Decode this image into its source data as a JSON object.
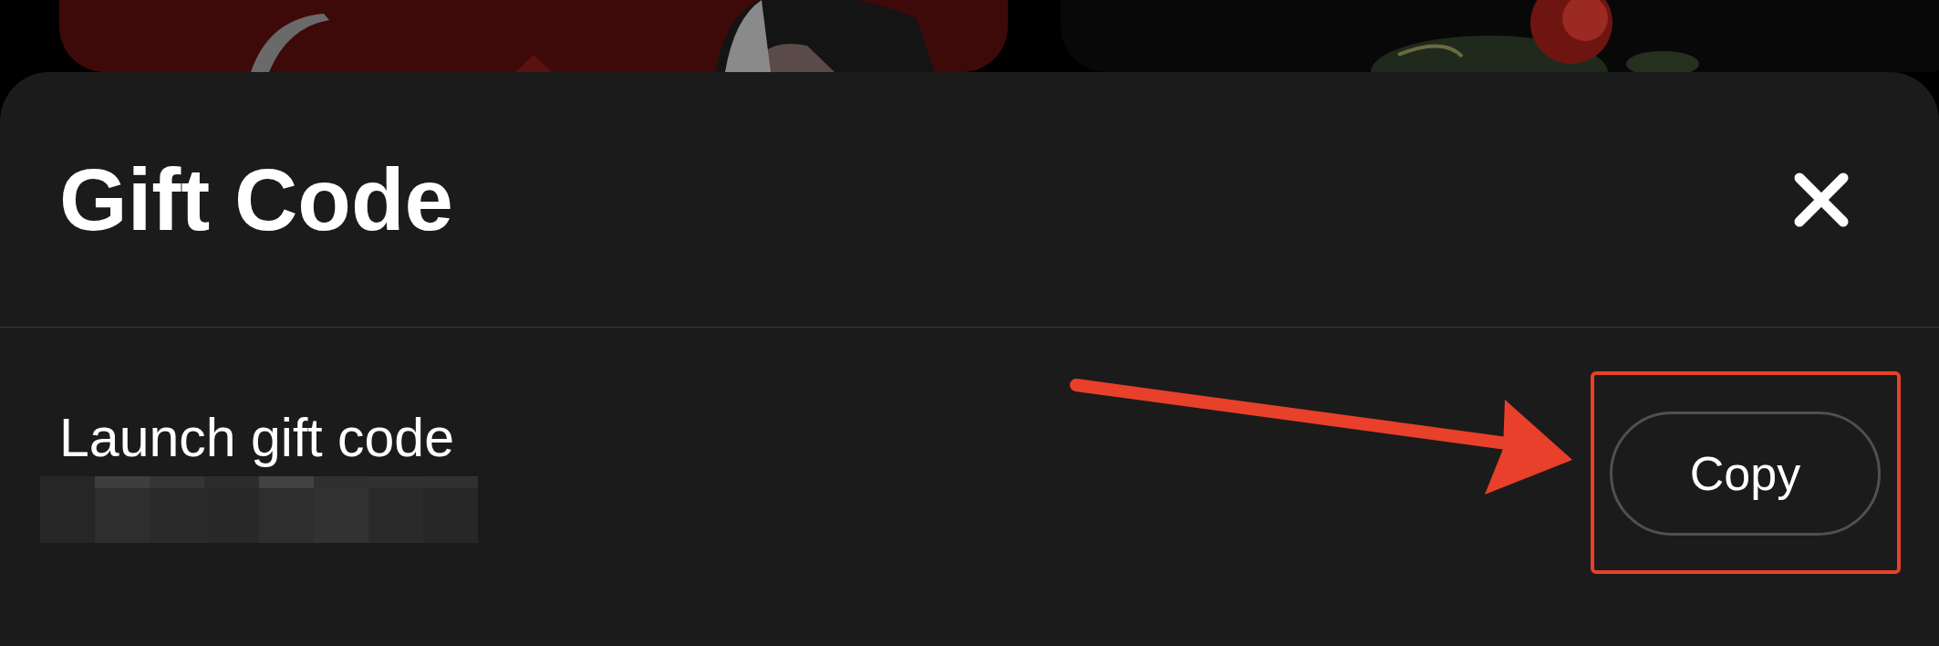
{
  "sheet": {
    "title": "Gift Code"
  },
  "gift_code": {
    "label": "Launch gift code",
    "code_hidden": true,
    "button": "Copy"
  }
}
